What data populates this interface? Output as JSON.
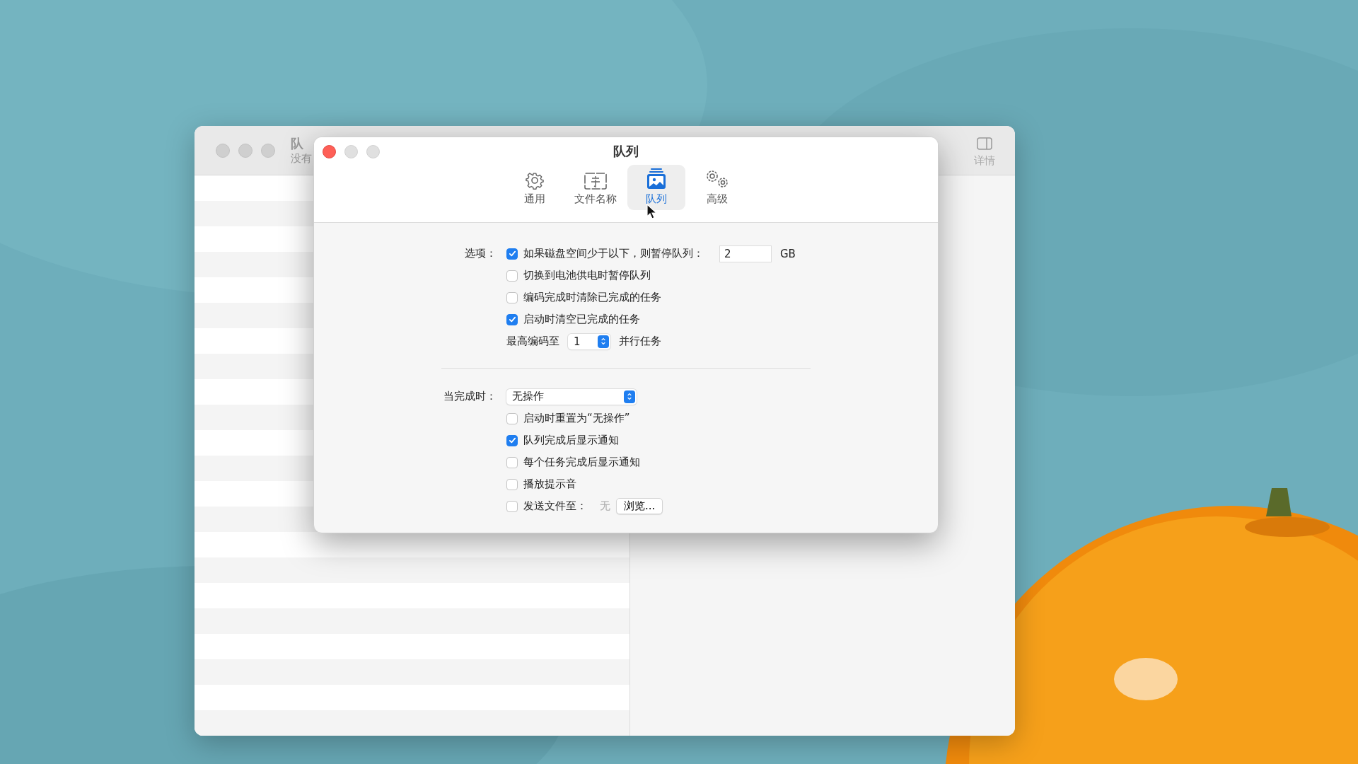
{
  "background_window": {
    "title": "队",
    "subtitle": "没有",
    "toolbar_button": "详情"
  },
  "preferences": {
    "title": "队列",
    "tabs": [
      {
        "label": "通用",
        "kind": "general",
        "selected": false
      },
      {
        "label": "文件名称",
        "kind": "filename",
        "selected": false
      },
      {
        "label": "队列",
        "kind": "queue",
        "selected": true
      },
      {
        "label": "高级",
        "kind": "advanced",
        "selected": false
      }
    ],
    "options": {
      "label": "选项：",
      "items": [
        {
          "kind": "checkbox",
          "label": "如果磁盘空间少于以下，则暂停队列：",
          "checked": true,
          "field_value": "2",
          "unit": "GB"
        },
        {
          "kind": "checkbox",
          "label": "切换到电池供电时暂停队列",
          "checked": false
        },
        {
          "kind": "checkbox",
          "label": "编码完成时清除已完成的任务",
          "checked": false
        },
        {
          "kind": "checkbox",
          "label": "启动时清空已完成的任务",
          "checked": true
        },
        {
          "kind": "stepper",
          "prefix": "最高编码至",
          "value": "1",
          "suffix": "并行任务"
        }
      ]
    },
    "on_complete": {
      "label": "当完成时：",
      "popup_value": "无操作",
      "items": [
        {
          "kind": "checkbox",
          "label": "启动时重置为“无操作”",
          "checked": false
        },
        {
          "kind": "checkbox",
          "label": "队列完成后显示通知",
          "checked": true
        },
        {
          "kind": "checkbox",
          "label": "每个任务完成后显示通知",
          "checked": false
        },
        {
          "kind": "checkbox",
          "label": "播放提示音",
          "checked": false
        },
        {
          "kind": "checkbox",
          "label": "发送文件至：",
          "checked": false,
          "path": "无",
          "button": "浏览..."
        }
      ]
    }
  }
}
